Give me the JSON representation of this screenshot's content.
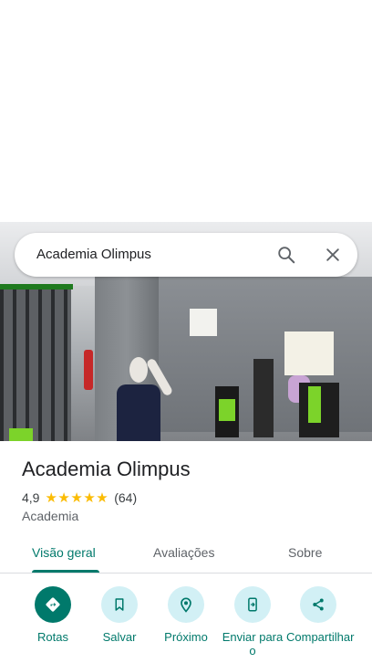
{
  "search": {
    "query": "Academia Olimpus"
  },
  "place": {
    "name": "Academia Olimpus",
    "rating": "4,9",
    "rating_value": 4.9,
    "stars": [
      "★",
      "★",
      "★",
      "★",
      "★"
    ],
    "review_count": "(64)",
    "category": "Academia"
  },
  "tabs": [
    {
      "label": "Visão geral",
      "active": true
    },
    {
      "label": "Avaliações",
      "active": false
    },
    {
      "label": "Sobre",
      "active": false
    }
  ],
  "actions": [
    {
      "label": "Rotas",
      "icon": "directions-icon"
    },
    {
      "label": "Salvar",
      "icon": "bookmark-icon"
    },
    {
      "label": "Próximo",
      "icon": "nearby-icon"
    },
    {
      "label": "Enviar para o",
      "icon": "send-to-phone-icon"
    },
    {
      "label": "Compartilhar",
      "icon": "share-icon"
    }
  ],
  "colors": {
    "accent": "#00796b",
    "action_bg": "#d2f0f5",
    "star": "#fbbc04"
  }
}
